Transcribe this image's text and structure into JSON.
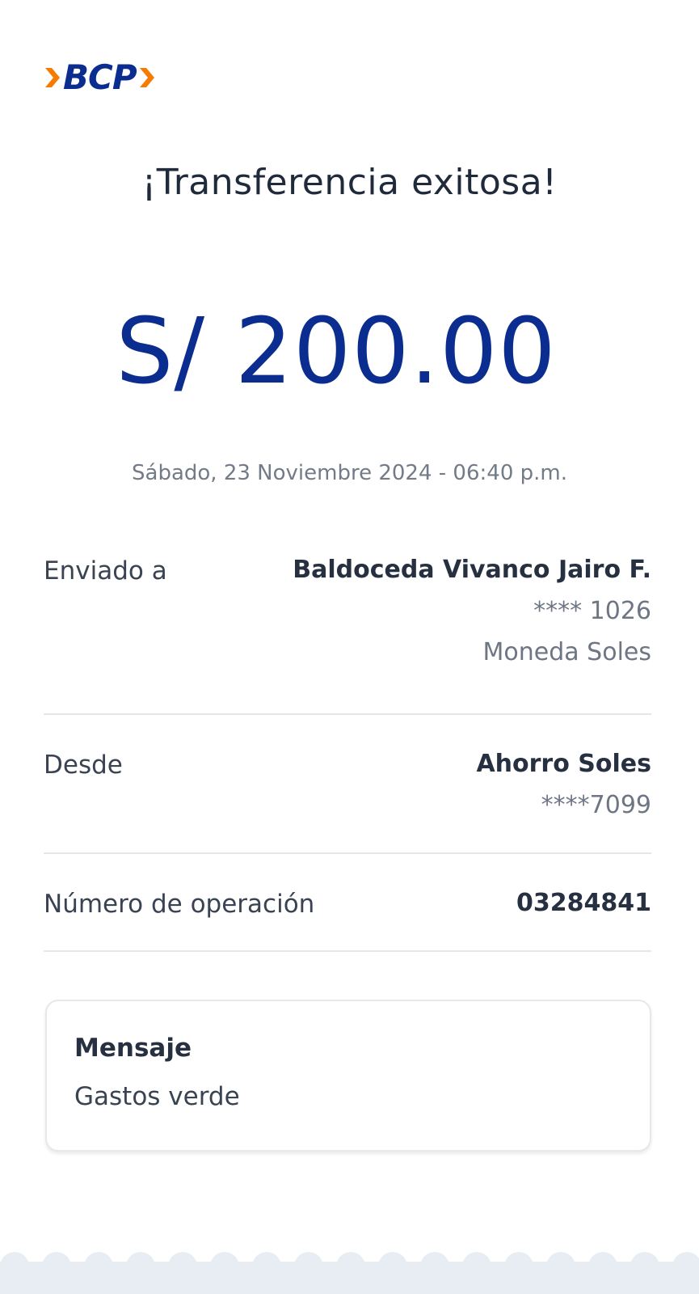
{
  "brand": {
    "logo_text": "BCP",
    "colors": {
      "blue": "#0a2d8f",
      "orange": "#f57c00"
    }
  },
  "receipt": {
    "title": "¡Transferencia exitosa!",
    "amount": "S/ 200.00",
    "datetime": "Sábado, 23 Noviembre 2024 - 06:40 p.m."
  },
  "details": {
    "sent_to": {
      "label": "Enviado a",
      "name": "Baldoceda Vivanco Jairo F.",
      "account": "**** 1026",
      "currency": "Moneda Soles"
    },
    "from": {
      "label": "Desde",
      "account_name": "Ahorro Soles",
      "account": "****7099"
    },
    "operation": {
      "label": "Número de operación",
      "number": "03284841"
    }
  },
  "message": {
    "title": "Mensaje",
    "text": "Gastos verde"
  },
  "colors": {
    "footer_band": "#e8ecf3"
  }
}
